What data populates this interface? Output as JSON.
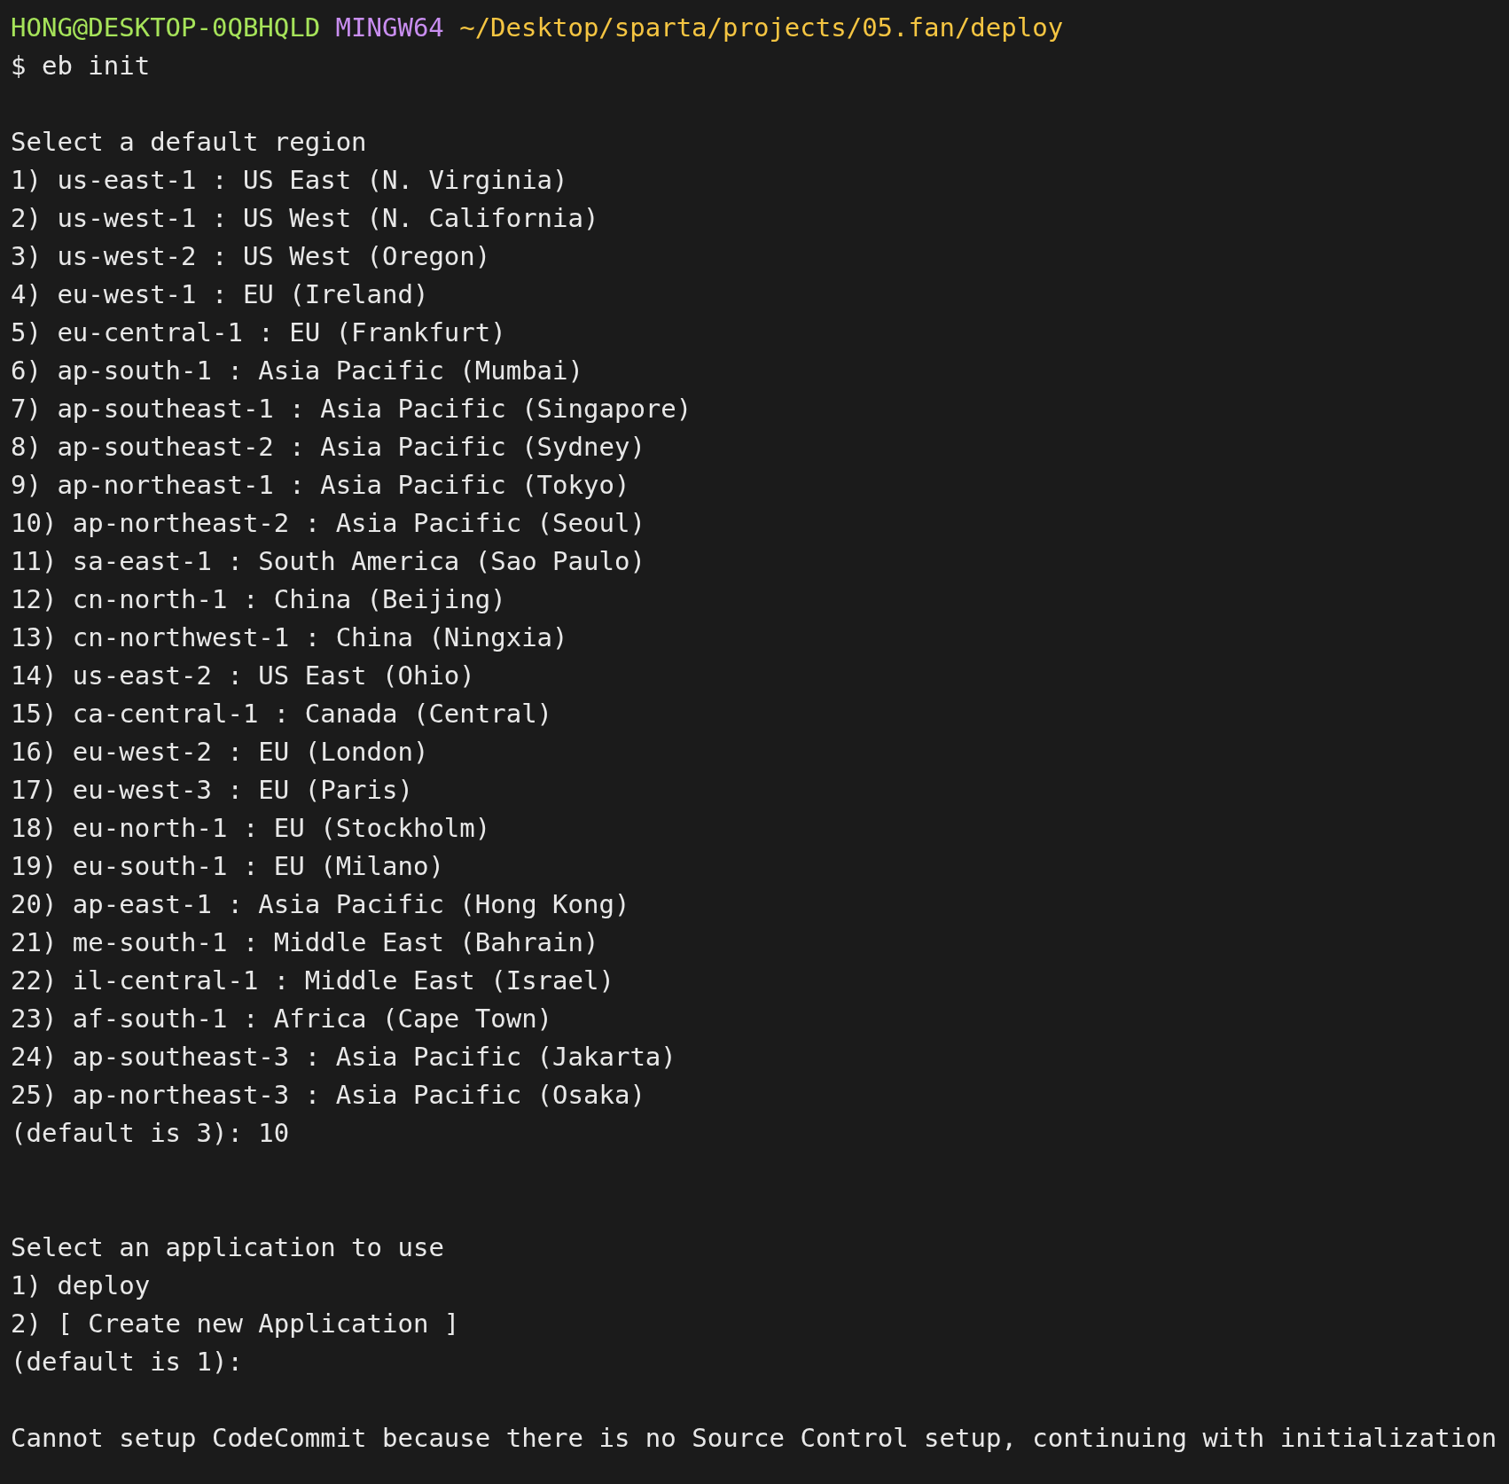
{
  "terminal": {
    "lines": [
      {
        "kind": "prompt",
        "user": "HONG@DESKTOP-0QBHQLD",
        "shell": "MINGW64",
        "path": "~/Desktop/sparta/projects/05.fan/deploy"
      },
      {
        "kind": "text",
        "text": "$ eb init"
      },
      {
        "kind": "blank"
      },
      {
        "kind": "text",
        "text": "Select a default region"
      },
      {
        "kind": "text",
        "text": "1) us-east-1 : US East (N. Virginia)"
      },
      {
        "kind": "text",
        "text": "2) us-west-1 : US West (N. California)"
      },
      {
        "kind": "text",
        "text": "3) us-west-2 : US West (Oregon)"
      },
      {
        "kind": "text",
        "text": "4) eu-west-1 : EU (Ireland)"
      },
      {
        "kind": "text",
        "text": "5) eu-central-1 : EU (Frankfurt)"
      },
      {
        "kind": "text",
        "text": "6) ap-south-1 : Asia Pacific (Mumbai)"
      },
      {
        "kind": "text",
        "text": "7) ap-southeast-1 : Asia Pacific (Singapore)"
      },
      {
        "kind": "text",
        "text": "8) ap-southeast-2 : Asia Pacific (Sydney)"
      },
      {
        "kind": "text",
        "text": "9) ap-northeast-1 : Asia Pacific (Tokyo)"
      },
      {
        "kind": "text",
        "text": "10) ap-northeast-2 : Asia Pacific (Seoul)"
      },
      {
        "kind": "text",
        "text": "11) sa-east-1 : South America (Sao Paulo)"
      },
      {
        "kind": "text",
        "text": "12) cn-north-1 : China (Beijing)"
      },
      {
        "kind": "text",
        "text": "13) cn-northwest-1 : China (Ningxia)"
      },
      {
        "kind": "text",
        "text": "14) us-east-2 : US East (Ohio)"
      },
      {
        "kind": "text",
        "text": "15) ca-central-1 : Canada (Central)"
      },
      {
        "kind": "text",
        "text": "16) eu-west-2 : EU (London)"
      },
      {
        "kind": "text",
        "text": "17) eu-west-3 : EU (Paris)"
      },
      {
        "kind": "text",
        "text": "18) eu-north-1 : EU (Stockholm)"
      },
      {
        "kind": "text",
        "text": "19) eu-south-1 : EU (Milano)"
      },
      {
        "kind": "text",
        "text": "20) ap-east-1 : Asia Pacific (Hong Kong)"
      },
      {
        "kind": "text",
        "text": "21) me-south-1 : Middle East (Bahrain)"
      },
      {
        "kind": "text",
        "text": "22) il-central-1 : Middle East (Israel)"
      },
      {
        "kind": "text",
        "text": "23) af-south-1 : Africa (Cape Town)"
      },
      {
        "kind": "text",
        "text": "24) ap-southeast-3 : Asia Pacific (Jakarta)"
      },
      {
        "kind": "text",
        "text": "25) ap-northeast-3 : Asia Pacific (Osaka)"
      },
      {
        "kind": "text",
        "text": "(default is 3): 10"
      },
      {
        "kind": "blank"
      },
      {
        "kind": "blank"
      },
      {
        "kind": "text",
        "text": "Select an application to use"
      },
      {
        "kind": "text",
        "text": "1) deploy"
      },
      {
        "kind": "text",
        "text": "2) [ Create new Application ]"
      },
      {
        "kind": "text",
        "text": "(default is 1):"
      },
      {
        "kind": "blank"
      },
      {
        "kind": "text",
        "text": "Cannot setup CodeCommit because there is no Source Control setup, continuing with initialization"
      }
    ]
  }
}
